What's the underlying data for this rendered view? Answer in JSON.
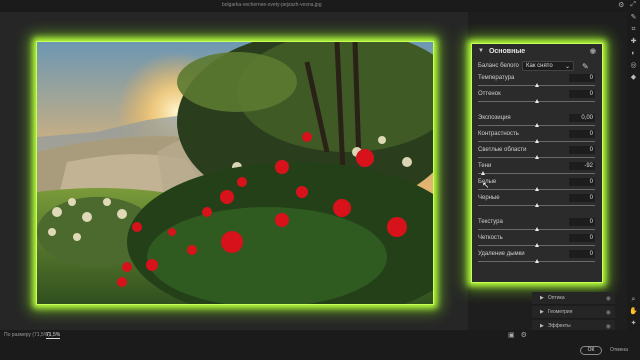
{
  "titlebar": {
    "filename": "bolgarka-vechernee-svety-pejzazh-vesna.jpg"
  },
  "panel": {
    "title": "Основные",
    "white_balance": {
      "label": "Баланс белого",
      "value": "Как снято"
    },
    "groups": [
      [
        {
          "label": "Температура",
          "value": "0",
          "level": 0.5
        },
        {
          "label": "Оттенок",
          "value": "0",
          "level": 0.5
        }
      ],
      [
        {
          "label": "Экспозиция",
          "value": "0,00",
          "level": 0.5
        },
        {
          "label": "Контрастность",
          "value": "0",
          "level": 0.5
        },
        {
          "label": "Светлые области",
          "value": "0",
          "level": 0.5
        },
        {
          "label": "Тени",
          "value": "-92",
          "level": 0.04
        },
        {
          "label": "Белые",
          "value": "0",
          "level": 0.5
        },
        {
          "label": "Черные",
          "value": "0",
          "level": 0.5
        }
      ],
      [
        {
          "label": "Текстура",
          "value": "0",
          "level": 0.5
        },
        {
          "label": "Четкость",
          "value": "0",
          "level": 0.5
        },
        {
          "label": "Удаление дымки",
          "value": "0",
          "level": 0.5
        }
      ]
    ]
  },
  "collapsed_sections": [
    {
      "label": "Оптика"
    },
    {
      "label": "Геометрия"
    },
    {
      "label": "Эффекты"
    },
    {
      "label": "Калибровка"
    }
  ],
  "bottombar": {
    "zoom_fit": "По размеру (71,5%)",
    "zoom_value": "71,5%",
    "ok": "ОК",
    "cancel": "Отмена"
  },
  "accent_color": "#b8ff3c"
}
